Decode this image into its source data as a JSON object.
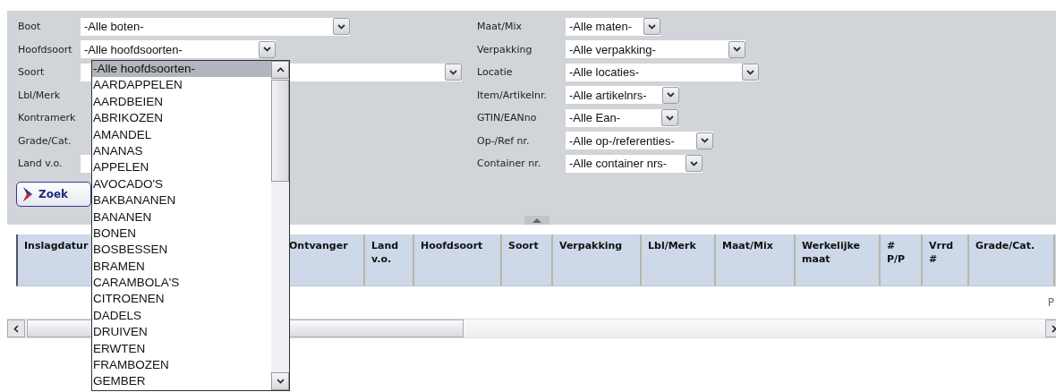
{
  "filters_left": [
    {
      "label": "Boot",
      "kind": "select",
      "value": "-Alle boten-"
    },
    {
      "label": "Hoofdsoort",
      "kind": "select",
      "value": "-Alle hoofdsoorten-"
    },
    {
      "label": "Soort",
      "kind": "covered"
    },
    {
      "label": "Lbl/Merk",
      "kind": "hidden"
    },
    {
      "label": "Kontramerk",
      "kind": "hidden"
    },
    {
      "label": "Grade/Cat.",
      "kind": "hidden"
    },
    {
      "label": "Land v.o.",
      "kind": "covered"
    }
  ],
  "filters_right": [
    {
      "label": "Maat/Mix",
      "value": "-Alle maten-"
    },
    {
      "label": "Verpakking",
      "value": "-Alle verpakking-"
    },
    {
      "label": "Locatie",
      "value": "-Alle locaties-"
    },
    {
      "label": "Item/Artikelnr.",
      "value": "-Alle artikelnrs-"
    },
    {
      "label": "GTIN/EANno",
      "value": "-Alle Ean-"
    },
    {
      "label": "Op-/Ref nr.",
      "value": "-Alle op-/referenties-"
    },
    {
      "label": "Container nr.",
      "value": "-Alle container nrs-"
    }
  ],
  "search_button": "Zoek",
  "dropdown": {
    "options": [
      {
        "label": "-Alle hoofdsoorten-",
        "selected": true
      },
      {
        "label": "AARDAPPELEN",
        "selected": false
      },
      {
        "label": "AARDBEIEN",
        "selected": false
      },
      {
        "label": "ABRIKOZEN",
        "selected": false
      },
      {
        "label": "AMANDEL",
        "selected": false
      },
      {
        "label": "ANANAS",
        "selected": false
      },
      {
        "label": "APPELEN",
        "selected": false
      },
      {
        "label": "AVOCADO'S",
        "selected": false
      },
      {
        "label": "BAKBANANEN",
        "selected": false
      },
      {
        "label": "BANANEN",
        "selected": false
      },
      {
        "label": "BONEN",
        "selected": false
      },
      {
        "label": "BOSBESSEN",
        "selected": false
      },
      {
        "label": "BRAMEN",
        "selected": false
      },
      {
        "label": "CARAMBOLA'S",
        "selected": false
      },
      {
        "label": "CITROENEN",
        "selected": false
      },
      {
        "label": "DADELS",
        "selected": false
      },
      {
        "label": "DRUIVEN",
        "selected": false
      },
      {
        "label": "ERWTEN",
        "selected": false
      },
      {
        "label": "FRAMBOZEN",
        "selected": false
      },
      {
        "label": "GEMBER",
        "selected": false
      }
    ]
  },
  "table": {
    "columns": [
      "Inslagdatur",
      "Ontvanger",
      "Land v.o.",
      "Hoofdsoort",
      "Soort",
      "Verpakking",
      "Lbl/Merk",
      "Maat/Mix",
      "Werkelijke maat",
      "# P/P",
      "Vrrd #",
      "Grade/Cat."
    ]
  },
  "pager_text": "P"
}
